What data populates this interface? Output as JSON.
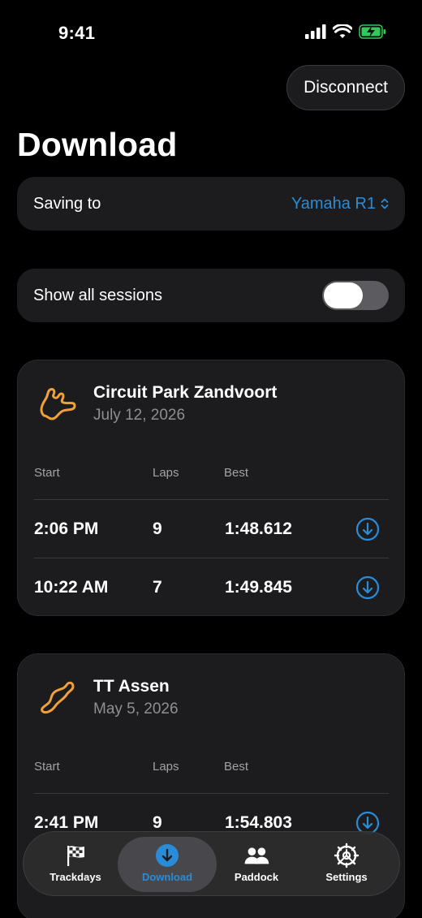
{
  "status": {
    "time": "9:41"
  },
  "header": {
    "disconnect_label": "Disconnect",
    "title": "Download"
  },
  "saving": {
    "label": "Saving to",
    "value": "Yamaha R1"
  },
  "show_all": {
    "label": "Show all sessions",
    "enabled": false
  },
  "columns": {
    "start": "Start",
    "laps": "Laps",
    "best": "Best"
  },
  "tracks": [
    {
      "name": "Circuit Park Zandvoort",
      "date": "July 12, 2026",
      "sessions": [
        {
          "start": "2:06 PM",
          "laps": "9",
          "best": "1:48.612"
        },
        {
          "start": "10:22 AM",
          "laps": "7",
          "best": "1:49.845"
        }
      ]
    },
    {
      "name": "TT Assen",
      "date": "May 5, 2026",
      "sessions": [
        {
          "start": "2:41 PM",
          "laps": "9",
          "best": "1:54.803"
        }
      ]
    }
  ],
  "tabs": [
    {
      "label": "Trackdays",
      "icon": "checkered-flag-icon"
    },
    {
      "label": "Download",
      "icon": "download-icon"
    },
    {
      "label": "Paddock",
      "icon": "people-icon"
    },
    {
      "label": "Settings",
      "icon": "gear-icon"
    }
  ],
  "colors": {
    "accent": "#2a8bd6",
    "track": "#f0a13a",
    "battery": "#34c759"
  }
}
